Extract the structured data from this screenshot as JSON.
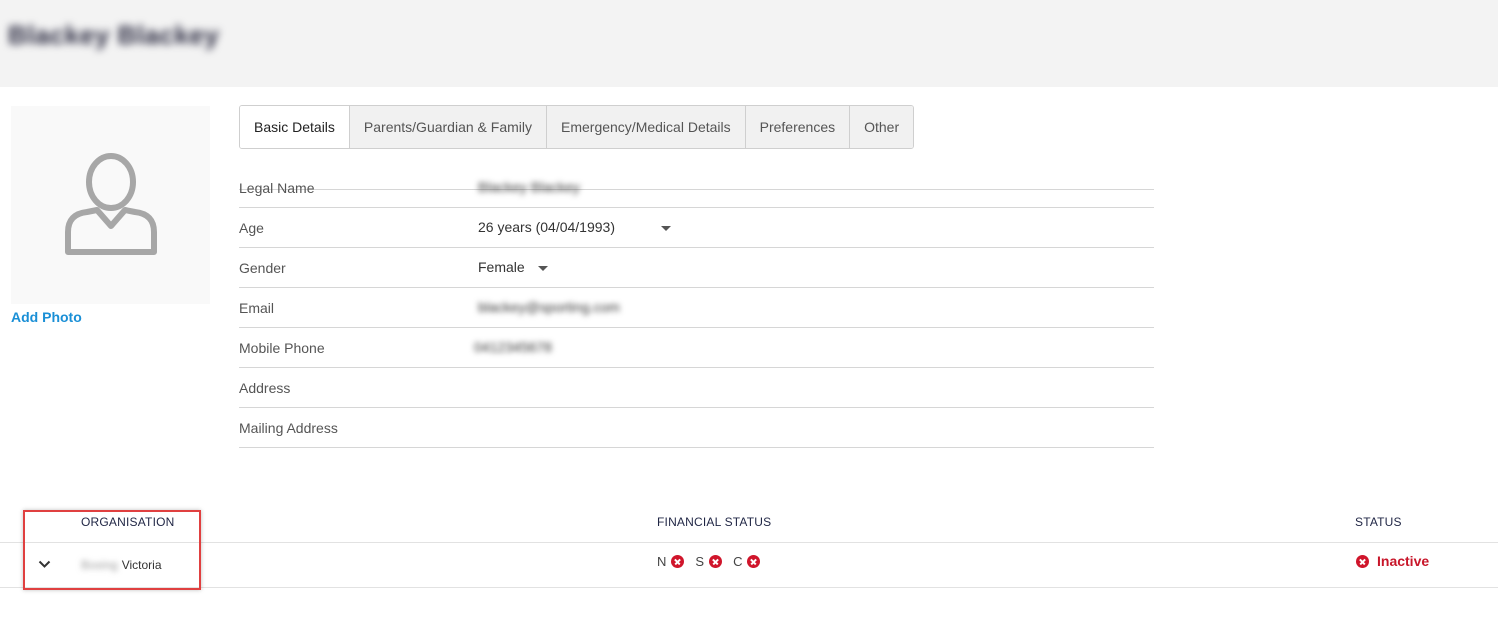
{
  "header": {
    "member_name": "Blackey Blackey"
  },
  "photo": {
    "add_photo_label": "Add Photo",
    "icon": "person-icon"
  },
  "tabs": [
    {
      "label": "Basic Details",
      "active": true
    },
    {
      "label": "Parents/Guardian & Family",
      "active": false
    },
    {
      "label": "Emergency/Medical Details",
      "active": false
    },
    {
      "label": "Preferences",
      "active": false
    },
    {
      "label": "Other",
      "active": false
    }
  ],
  "details": {
    "legal_name": {
      "label": "Legal Name",
      "value": "Blackey Blackey"
    },
    "age": {
      "label": "Age",
      "value": "26 years (04/04/1993)"
    },
    "gender": {
      "label": "Gender",
      "value": "Female"
    },
    "email": {
      "label": "Email",
      "value": "blackey@sporting.com"
    },
    "mobile_phone": {
      "label": "Mobile Phone",
      "value": "0412345678"
    },
    "address": {
      "label": "Address",
      "value": ""
    },
    "mailing_address": {
      "label": "Mailing Address",
      "value": ""
    }
  },
  "table": {
    "headers": {
      "organisation": "ORGANISATION",
      "financial_status": "FINANCIAL STATUS",
      "status": "STATUS"
    },
    "rows": [
      {
        "organisation_blurred": "Boxing",
        "organisation": "Victoria",
        "financial": [
          {
            "code": "N"
          },
          {
            "code": "S"
          },
          {
            "code": "C"
          }
        ],
        "status": "Inactive"
      }
    ]
  },
  "colors": {
    "accent": "#1a8fd6",
    "error": "#d0152b",
    "highlight": "#e04040"
  }
}
